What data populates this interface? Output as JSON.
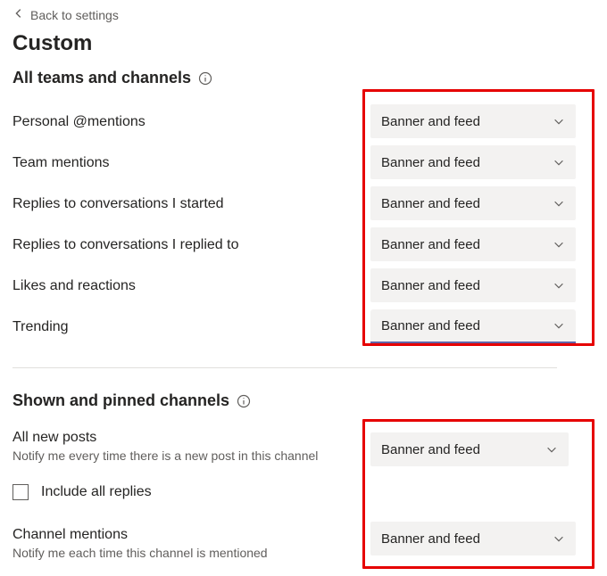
{
  "backLink": "Back to settings",
  "title": "Custom",
  "section1": {
    "heading": "All teams and channels",
    "settings": [
      {
        "label": "Personal @mentions",
        "value": "Banner and feed"
      },
      {
        "label": "Team mentions",
        "value": "Banner and feed"
      },
      {
        "label": "Replies to conversations I started",
        "value": "Banner and feed"
      },
      {
        "label": "Replies to conversations I replied to",
        "value": "Banner and feed"
      },
      {
        "label": "Likes and reactions",
        "value": "Banner and feed"
      },
      {
        "label": "Trending",
        "value": "Banner and feed"
      }
    ]
  },
  "section2": {
    "heading": "Shown and pinned channels",
    "allNewPosts": {
      "label": "All new posts",
      "sublabel": "Notify me every time there is a new post in this channel",
      "value": "Banner and feed"
    },
    "includeAllReplies": {
      "label": "Include all replies",
      "checked": false
    },
    "channelMentions": {
      "label": "Channel mentions",
      "sublabel": "Notify me each time this channel is mentioned",
      "value": "Banner and feed"
    }
  }
}
